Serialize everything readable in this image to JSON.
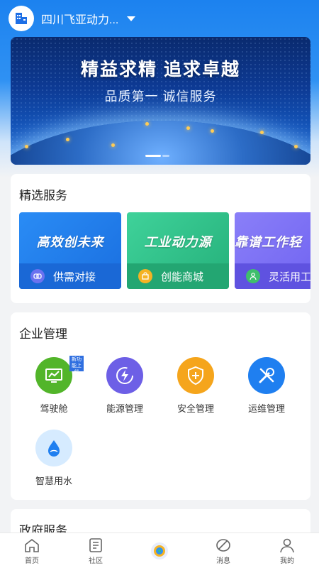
{
  "header": {
    "company_name": "四川飞亚动力...",
    "logo_icon": "building-icon",
    "dropdown_icon": "caret-down-icon"
  },
  "banner": {
    "title": "精益求精  追求卓越",
    "subtitle": "品质第一  诚信服务"
  },
  "services": {
    "title": "精选服务",
    "items": [
      {
        "slogan": "高效创未来",
        "label": "供需对接",
        "icon": "link-icon",
        "color": "#1f80f0"
      },
      {
        "slogan": "工业动力源",
        "label": "创能商城",
        "icon": "shop-icon",
        "color": "#2fbf8a"
      },
      {
        "slogan": "靠谱工作轻",
        "label": "灵活用工",
        "icon": "worker-icon",
        "color": "#7b6ff5"
      }
    ]
  },
  "management": {
    "title": "企业管理",
    "new_badge": "新功能上线",
    "items": [
      {
        "label": "驾驶舱",
        "icon": "dashboard-icon",
        "color": "#52b52a"
      },
      {
        "label": "能源管理",
        "icon": "energy-icon",
        "color": "#6d5fe6"
      },
      {
        "label": "安全管理",
        "icon": "shield-plus-icon",
        "color": "#f5a51c"
      },
      {
        "label": "运维管理",
        "icon": "tools-icon",
        "color": "#1f7ff0"
      },
      {
        "label": "智慧用水",
        "icon": "water-drop-icon",
        "color": "#d6ebff"
      }
    ]
  },
  "government": {
    "title": "政府服务"
  },
  "tabbar": {
    "tabs": [
      {
        "label": "首页",
        "icon": "home-icon"
      },
      {
        "label": "社区",
        "icon": "community-icon"
      },
      {
        "label": "",
        "icon": "center-logo-icon"
      },
      {
        "label": "消息",
        "icon": "message-icon"
      },
      {
        "label": "我的",
        "icon": "profile-icon"
      }
    ]
  }
}
